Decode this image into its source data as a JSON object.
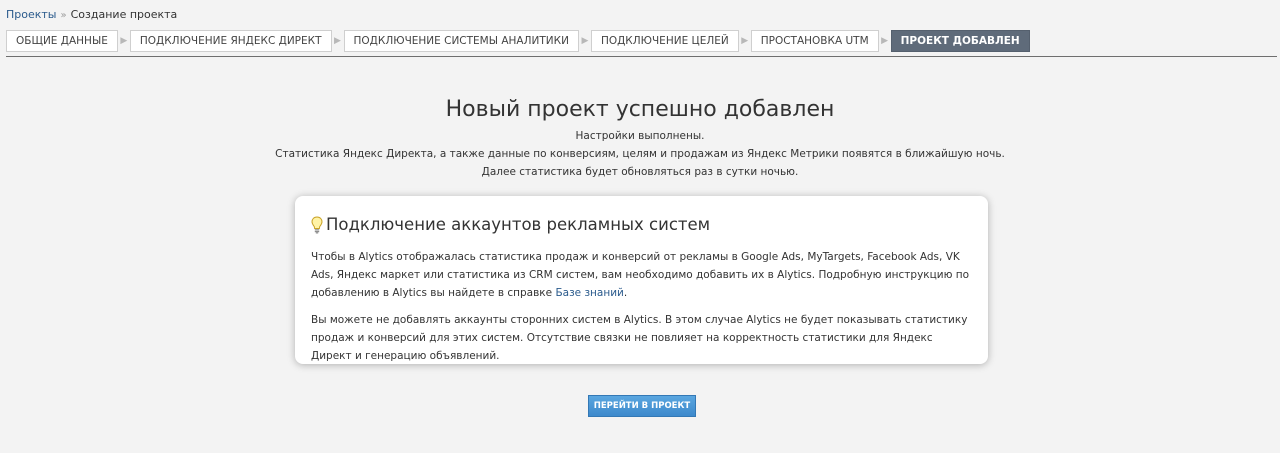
{
  "breadcrumb": {
    "projects_link": "Проекты",
    "separator": "»",
    "current": "Создание проекта"
  },
  "steps": [
    {
      "label": "ОБЩИЕ ДАННЫЕ",
      "active": false
    },
    {
      "label": "ПОДКЛЮЧЕНИЕ ЯНДЕКС ДИРЕКТ",
      "active": false
    },
    {
      "label": "ПОДКЛЮЧЕНИЕ СИСТЕМЫ АНАЛИТИКИ",
      "active": false
    },
    {
      "label": "ПОДКЛЮЧЕНИЕ ЦЕЛЕЙ",
      "active": false
    },
    {
      "label": "ПРОСТАНОВКА UTM",
      "active": false
    },
    {
      "label": "ПРОЕКТ ДОБАВЛЕН",
      "active": true
    }
  ],
  "step_separator": "▶",
  "main": {
    "title": "Новый проект успешно добавлен",
    "line1": "Настройки выполнены.",
    "line2": "Статистика Яндекс Директа, а также данные по конверсиям, целям и продажам из Яндекс Метрики появятся в ближайшую ночь.",
    "line3": "Далее статистика будет обновляться раз в сутки ночью."
  },
  "card": {
    "icon": "lightbulb-icon",
    "title": "Подключение аккаунтов рекламных систем",
    "para1_text": "Чтобы в Alytics отображалась статистика продаж и конверсий от рекламы в Google Ads, MyTargets, Facebook Ads, VK Ads, Яндекс маркет или статистика из CRM систем, вам необходимо добавить их в Alytics. Подробную инструкцию по добавлению в Alytics вы найдете в справке ",
    "para1_link": "Базе знаний",
    "para1_end": ".",
    "para2": "Вы можете не добавлять аккаунты сторонних систем в Alytics. В этом случае Alytics не будет показывать статистику продаж и конверсий для этих систем. Отсутствие связки не повлияет на корректность статистики для Яндекс Директ и генерацию объявлений."
  },
  "go_button_label": "ПЕРЕЙТИ В ПРОЕКТ",
  "colors": {
    "background": "#f3f3f3",
    "link": "#2a5a8c",
    "active_step": "#5f6b7a",
    "button": "#4a95d6"
  }
}
